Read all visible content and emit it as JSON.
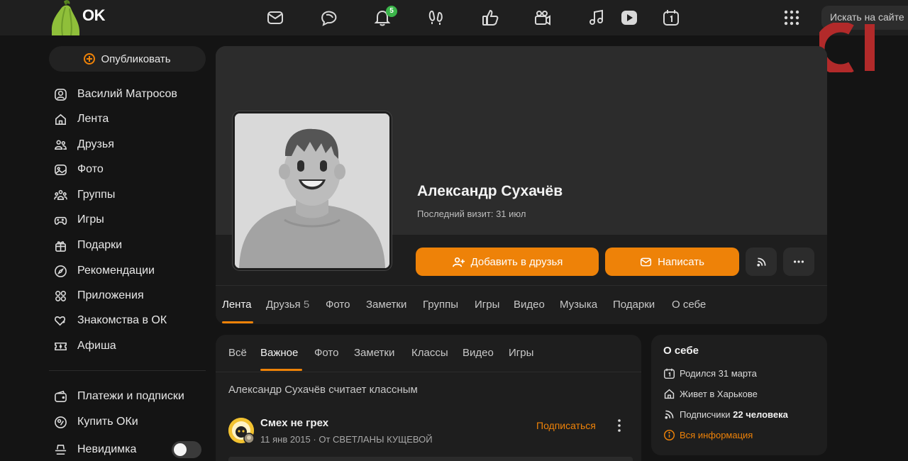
{
  "brand": {
    "name": "OK"
  },
  "topbar": {
    "notifications_count": "5",
    "search_placeholder": "Искать на сайте",
    "icons": [
      "mail-icon",
      "chat-icon",
      "bell-icon",
      "footprints-icon",
      "like-icon",
      "video-camera-icon",
      "music-icon",
      "video-play-icon",
      "calendar-icon",
      "apps-grid-icon"
    ]
  },
  "sidebar": {
    "publish_label": "Опубликовать",
    "items": [
      {
        "label": "Василий Матросов",
        "icon": "user-icon"
      },
      {
        "label": "Лента",
        "icon": "home-icon"
      },
      {
        "label": "Друзья",
        "icon": "friends-icon"
      },
      {
        "label": "Фото",
        "icon": "photo-icon"
      },
      {
        "label": "Группы",
        "icon": "groups-icon"
      },
      {
        "label": "Игры",
        "icon": "gamepad-icon"
      },
      {
        "label": "Подарки",
        "icon": "gift-icon"
      },
      {
        "label": "Рекомендации",
        "icon": "compass-icon"
      },
      {
        "label": "Приложения",
        "icon": "apps-icon"
      },
      {
        "label": "Знакомства в ОК",
        "icon": "hearts-icon"
      },
      {
        "label": "Афиша",
        "icon": "ticket-icon"
      }
    ],
    "bottom_items": [
      {
        "label": "Платежи и подписки",
        "icon": "wallet-icon"
      },
      {
        "label": "Купить ОКи",
        "icon": "coin-icon"
      },
      {
        "label": "Невидимка",
        "icon": "incognito-icon",
        "toggle_on": false
      }
    ]
  },
  "profile": {
    "name": "Александр Сухачёв",
    "last_visit": "Последний визит: 31 июл",
    "add_friend_label": "Добавить в друзья",
    "message_label": "Написать",
    "tabs": [
      {
        "label": "Лента",
        "count": ""
      },
      {
        "label": "Друзья",
        "count": "5"
      },
      {
        "label": "Фото",
        "count": ""
      },
      {
        "label": "Заметки",
        "count": ""
      },
      {
        "label": "Группы",
        "count": ""
      },
      {
        "label": "Игры",
        "count": ""
      },
      {
        "label": "Видео",
        "count": ""
      },
      {
        "label": "Музыка",
        "count": ""
      },
      {
        "label": "Подарки",
        "count": ""
      },
      {
        "label": "О себе",
        "count": ""
      }
    ],
    "active_tab": "Лента"
  },
  "feed": {
    "tabs": [
      "Всё",
      "Важное",
      "Фото",
      "Заметки",
      "Классы",
      "Видео",
      "Игры"
    ],
    "active_tab": "Важное",
    "note": "Александр Сухачёв считает классным",
    "post": {
      "group_name": "Смех не грех",
      "date": "11 янв 2015",
      "from": "От СВЕТЛАНЫ КУЩЕВОЙ",
      "subscribe_label": "Подписаться"
    }
  },
  "about": {
    "title": "О себе",
    "birthday": "Родился 31 марта",
    "lives": "Живет в Харькове",
    "followers_label": "Подписчики",
    "followers_value": "22 человека",
    "all_info": "Вся информация"
  },
  "colors": {
    "accent": "#ee8208",
    "badge": "#3bb54a",
    "background": "#141414",
    "card": "#1e1e1e",
    "watermark": "#b22a2a"
  }
}
